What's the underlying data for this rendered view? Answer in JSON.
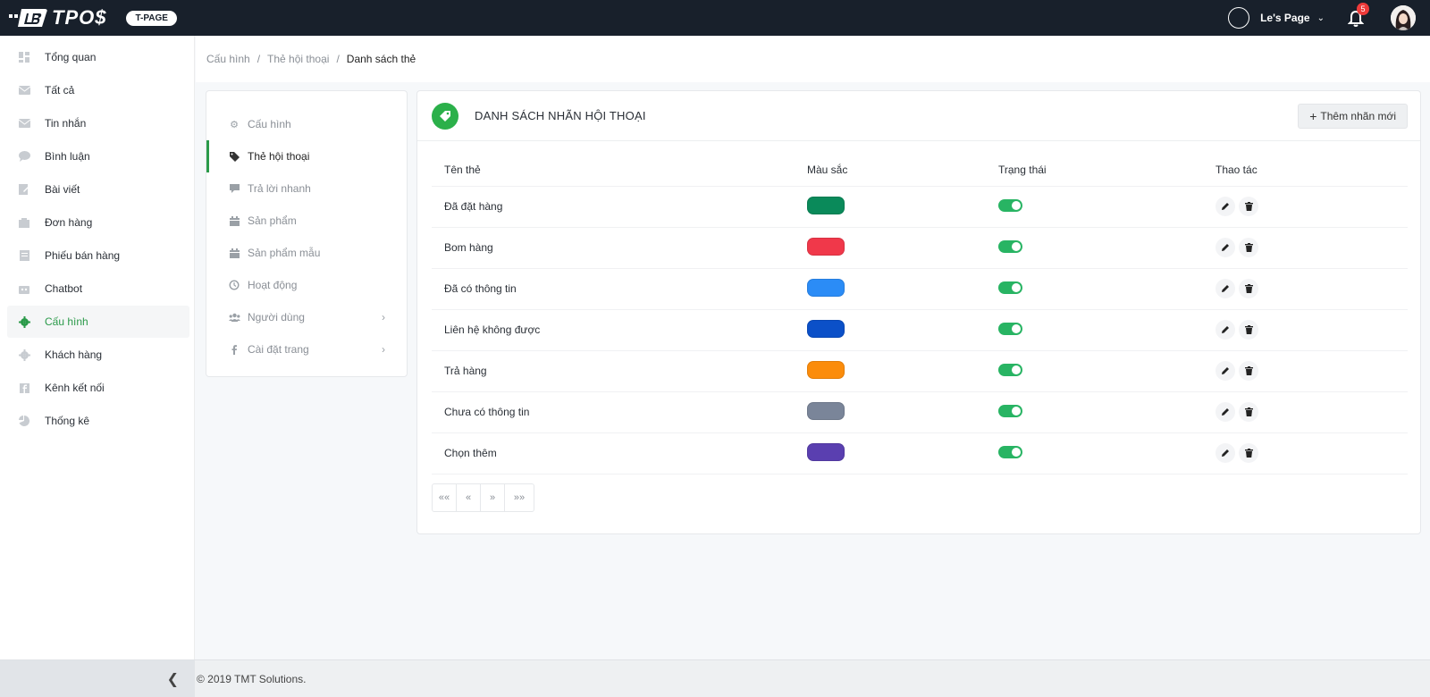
{
  "topbar": {
    "logo_text": "TPO$",
    "badge": "T-PAGE",
    "page_name": "Le's Page",
    "notification_count": "5"
  },
  "sidebar": {
    "items": [
      {
        "label": "Tổng quan",
        "icon": "dashboard-icon"
      },
      {
        "label": "Tất cả",
        "icon": "inbox-icon"
      },
      {
        "label": "Tin nhắn",
        "icon": "envelope-icon"
      },
      {
        "label": "Bình luận",
        "icon": "comment-icon"
      },
      {
        "label": "Bài viết",
        "icon": "edit-icon"
      },
      {
        "label": "Đơn hàng",
        "icon": "cart-icon"
      },
      {
        "label": "Phiếu bán hàng",
        "icon": "receipt-icon"
      },
      {
        "label": "Chatbot",
        "icon": "robot-icon"
      },
      {
        "label": "Cấu hình",
        "icon": "gear-icon",
        "active": true
      },
      {
        "label": "Khách hàng",
        "icon": "gear-icon"
      },
      {
        "label": "Kênh kết nối",
        "icon": "facebook-icon"
      },
      {
        "label": "Thống kê",
        "icon": "pie-chart-icon"
      }
    ]
  },
  "breadcrumb": [
    "Cấu hình",
    "Thẻ hội thoại",
    "Danh sách thẻ"
  ],
  "submenu": {
    "items": [
      {
        "label": "Cấu hình",
        "icon": "gear-icon"
      },
      {
        "label": "Thẻ hội thoại",
        "icon": "tag-icon",
        "active": true
      },
      {
        "label": "Trả lời nhanh",
        "icon": "comment-icon"
      },
      {
        "label": "Sản phẩm",
        "icon": "calendar-icon"
      },
      {
        "label": "Sản phẩm mẫu",
        "icon": "calendar-icon"
      },
      {
        "label": "Hoạt động",
        "icon": "history-icon"
      },
      {
        "label": "Người dùng",
        "icon": "users-icon",
        "has_arrow": true
      },
      {
        "label": "Cài đặt trang",
        "icon": "facebook-icon",
        "has_arrow": true
      }
    ]
  },
  "card": {
    "title": "DANH SÁCH NHÃN HỘI THOẠI",
    "add_button": "Thêm nhãn mới",
    "columns": [
      "Tên thẻ",
      "Màu sắc",
      "Trạng thái",
      "Thao tác"
    ],
    "rows": [
      {
        "name": "Đã đặt hàng",
        "color": "#0a8a5a",
        "enabled": true
      },
      {
        "name": "Bom hàng",
        "color": "#f0384a",
        "enabled": true
      },
      {
        "name": "Đã có thông tin",
        "color": "#2b8cf6",
        "enabled": true
      },
      {
        "name": "Liên hệ không được",
        "color": "#0b50c8",
        "enabled": true
      },
      {
        "name": "Trả hàng",
        "color": "#fb8c0b",
        "enabled": true
      },
      {
        "name": "Chưa có thông tin",
        "color": "#7a8599",
        "enabled": true
      },
      {
        "name": "Chọn thêm",
        "color": "#5a3fb0",
        "enabled": true
      }
    ],
    "pager": [
      "««",
      "«",
      "»",
      "»»"
    ]
  },
  "footer": {
    "copyright": "© 2019 TMT Solutions."
  }
}
